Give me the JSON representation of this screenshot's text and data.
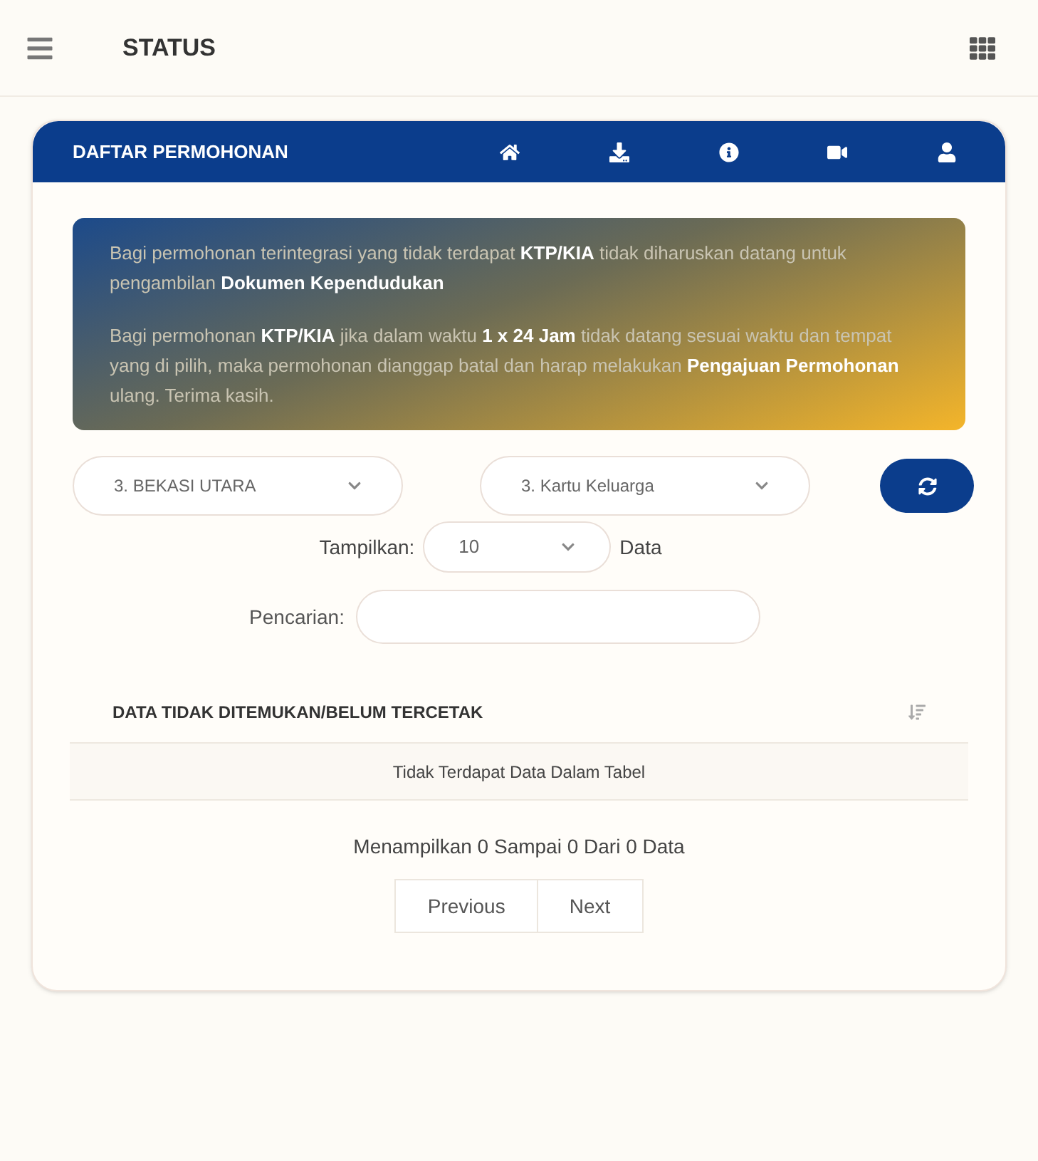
{
  "app_bar": {
    "title": "STATUS"
  },
  "card": {
    "title": "DAFTAR PERMOHONAN",
    "toolbar_icons": [
      {
        "kind": "home"
      },
      {
        "kind": "download"
      },
      {
        "kind": "info"
      },
      {
        "kind": "video"
      },
      {
        "kind": "user"
      }
    ]
  },
  "notice": [
    "Bagi permohonan terintegrasi yang tidak terdapat **KTP/KIA** tidak diharuskan datang untuk pengambilan **Dokumen Kependudukan**",
    "Bagi permohonan **KTP/KIA** jika dalam waktu **1 x 24 Jam** tidak datang sesuai waktu dan tempat yang di pilih, maka permohonan dianggap batal dan harap melakukan **Pengajuan Permohonan** ulang. Terima kasih."
  ],
  "filters": [
    {
      "value": "3. BEKASI UTARA"
    },
    {
      "value": "3. Kartu Keluarga"
    }
  ],
  "page_size": {
    "label": "Tampilkan:",
    "value": "10",
    "suffix": "Data"
  },
  "search": {
    "label": "Pencarian:"
  },
  "table": {
    "columns": [
      "DATA TIDAK DITEMUKAN/BELUM TERCETAK"
    ],
    "empty_message": "Tidak Terdapat Data Dalam Tabel"
  },
  "summary": "Menampilkan 0 Sampai 0 Dari 0 Data",
  "pagination": [
    "Previous",
    "Next"
  ]
}
